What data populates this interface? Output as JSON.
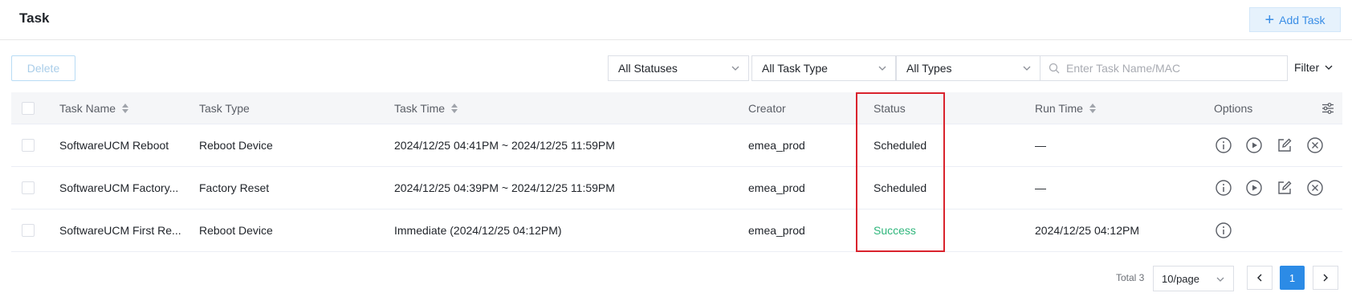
{
  "header": {
    "title": "Task",
    "add_label": "Add Task"
  },
  "toolbar": {
    "delete_label": "Delete",
    "status_select": "All Statuses",
    "task_type_select": "All Task Type",
    "types_select": "All Types",
    "search_placeholder": "Enter Task Name/MAC",
    "filter_label": "Filter"
  },
  "table": {
    "columns": {
      "task_name": "Task Name",
      "task_type": "Task Type",
      "task_time": "Task Time",
      "creator": "Creator",
      "status": "Status",
      "run_time": "Run Time",
      "options": "Options"
    },
    "rows": [
      {
        "task_name": "SoftwareUCM Reboot",
        "task_type": "Reboot Device",
        "task_time": "2024/12/25 04:41PM ~ 2024/12/25 11:59PM",
        "creator": "emea_prod",
        "status": "Scheduled",
        "run_time": "—"
      },
      {
        "task_name": "SoftwareUCM Factory...",
        "task_type": "Factory Reset",
        "task_time": "2024/12/25 04:39PM ~ 2024/12/25 11:59PM",
        "creator": "emea_prod",
        "status": "Scheduled",
        "run_time": "—"
      },
      {
        "task_name": "SoftwareUCM First Re...",
        "task_type": "Reboot Device",
        "task_time": "Immediate (2024/12/25 04:12PM)",
        "creator": "emea_prod",
        "status": "Success",
        "run_time": "2024/12/25 04:12PM"
      }
    ]
  },
  "pagination": {
    "total": "Total 3",
    "page_size": "10/page",
    "current_page": "1"
  },
  "colors": {
    "accent": "#2c8be6",
    "success": "#2fb67c",
    "highlight": "#d9232d"
  }
}
